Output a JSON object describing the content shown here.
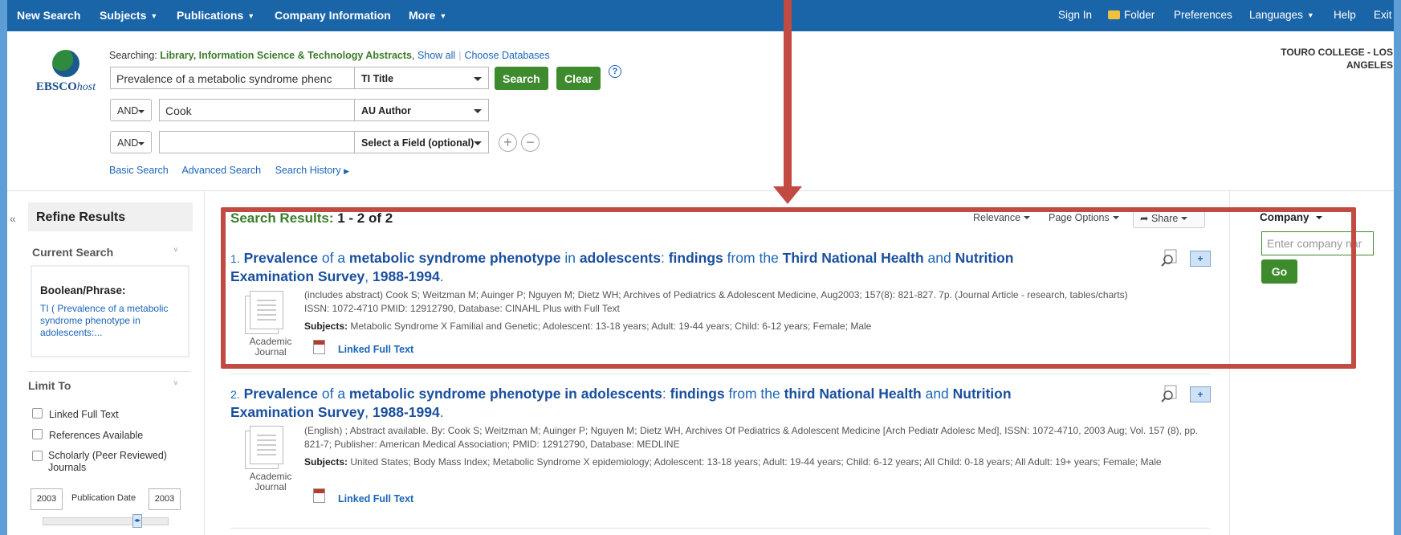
{
  "topnav": {
    "left": [
      "New Search",
      "Subjects",
      "Publications",
      "Company Information",
      "More"
    ],
    "right": [
      "Sign In",
      "Folder",
      "Preferences",
      "Languages",
      "Help",
      "Exit"
    ]
  },
  "logo": {
    "brand": "EBSCO",
    "suffix": "host"
  },
  "search": {
    "searching_label": "Searching:",
    "database": "Library, Information Science & Technology Abstracts",
    "show_all": "Show all",
    "choose_databases": "Choose Databases",
    "row1_value": "Prevalence of a metabolic syndrome phenc",
    "row1_field": "TI Title",
    "row2_bool": "AND",
    "row2_value": "Cook",
    "row2_field": "AU Author",
    "row3_bool": "AND",
    "row3_value": "",
    "row3_field": "Select a Field (optional)",
    "search_btn": "Search",
    "clear_btn": "Clear",
    "help": "?",
    "add": "+",
    "remove": "−",
    "links": [
      "Basic Search",
      "Advanced Search",
      "Search History"
    ]
  },
  "institution": "TOURO COLLEGE - LOS ANGELES",
  "sidebar": {
    "collapse": "«",
    "refine_title": "Refine Results",
    "current_search_title": "Current Search",
    "boolean_label": "Boolean/Phrase:",
    "query": "TI ( Prevalence of a metabolic syndrome phenotype in adolescents:...",
    "limit_title": "Limit To",
    "limits": [
      "Linked Full Text",
      "References Available",
      "Scholarly (Peer Reviewed) Journals"
    ],
    "date_from": "2003",
    "date_to": "2003",
    "date_label": "Publication Date"
  },
  "results": {
    "heading_label": "Search Results:",
    "heading_range": "1 - 2 of 2",
    "relevance": "Relevance",
    "page_options": "Page Options",
    "share": "Share",
    "items": [
      {
        "num": "1.",
        "meta_line1": "(includes abstract) Cook S; Weitzman M; Auinger P; Nguyen M; Dietz WH; Archives of Pediatrics & Adolescent Medicine, Aug2003; 157(8): 821-827. 7p. (Journal Article - research, tables/charts)",
        "meta_line2": "ISSN: 1072-4710 PMID: 12912790, Database: CINAHL Plus with Full Text",
        "subjects_label": "Subjects:",
        "subjects": "Metabolic Syndrome X Familial and Genetic; Adolescent: 13-18 years; Adult: 19-44 years; Child: 6-12 years; Female; Male",
        "type": "Academic Journal",
        "full_text": "Linked Full Text"
      },
      {
        "num": "2.",
        "meta": "(English) ; Abstract available. By: Cook S; Weitzman M; Auinger P; Nguyen M; Dietz WH, Archives Of Pediatrics & Adolescent Medicine [Arch Pediatr Adolesc Med], ISSN: 1072-4710, 2003 Aug; Vol. 157 (8), pp. 821-7; Publisher: American Medical Association; PMID: 12912790, Database: MEDLINE",
        "subjects_label": "Subjects:",
        "subjects": "United States; Body Mass Index; Metabolic Syndrome X epidemiology; Adolescent: 13-18 years; Adult: 19-44 years; Child: 6-12 years; All Child: 0-18 years; All Adult: 19+ years; Female; Male",
        "type": "Academic Journal",
        "full_text": "Linked Full Text"
      }
    ]
  },
  "company": {
    "title": "Company",
    "placeholder": "Enter company nar",
    "go": "Go"
  },
  "colors": {
    "nav": "#1a65a8",
    "green": "#3d8b2c",
    "link": "#1a65b8",
    "annotation": "#c14a42"
  }
}
